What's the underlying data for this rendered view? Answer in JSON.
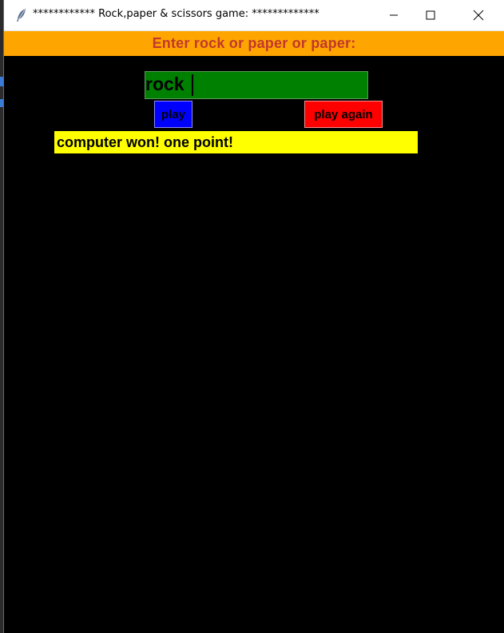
{
  "window": {
    "title": "************ Rock,paper & scissors game: *************"
  },
  "prompt": {
    "text": "Enter rock or paper or paper:"
  },
  "input": {
    "value": "rock"
  },
  "buttons": {
    "play_label": "play",
    "play_again_label": "play again"
  },
  "result": {
    "text": "computer won! one point!"
  },
  "colors": {
    "prompt_bar": "#ffa500",
    "prompt_text": "#c0392b",
    "input_bg": "#008000",
    "play_button": "#0000ff",
    "play_again_button": "#ff0000",
    "result_bg": "#ffff00",
    "canvas": "#000000"
  },
  "icons": {
    "app": "feather-icon",
    "minimize": "minimize-icon",
    "maximize": "maximize-icon",
    "close": "close-icon"
  }
}
